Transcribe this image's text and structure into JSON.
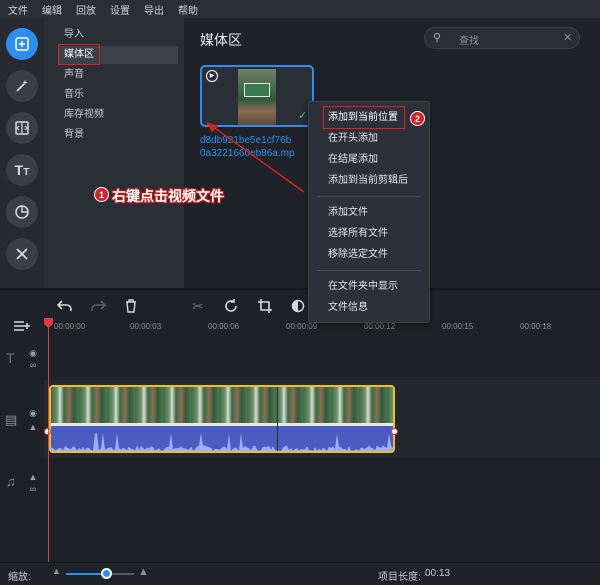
{
  "menu": [
    "文件",
    "编辑",
    "回放",
    "设置",
    "导出",
    "帮助"
  ],
  "sidebar_categories": [
    "导入",
    "媒体区",
    "声音",
    "音乐",
    "库存视频",
    "背景"
  ],
  "media": {
    "title": "媒体区",
    "search_placeholder": "查找",
    "file_name_line1": "d8db921be5e1cf76b",
    "file_name_line2": "0a3221660eb86a.mp"
  },
  "context_menu": {
    "group1": [
      "添加到当前位置",
      "在开头添加",
      "在结尾添加",
      "添加到当前剪辑后"
    ],
    "group2": [
      "添加文件",
      "选择所有文件",
      "移除选定文件"
    ],
    "group3": [
      "在文件夹中显示",
      "文件信息"
    ]
  },
  "annotations": {
    "badge1": "1",
    "badge2": "2",
    "step1_text": "右键点击视频文件"
  },
  "timeline": {
    "ticks": [
      "00:00:00",
      "00:00:03",
      "00:00:06",
      "00:00:09",
      "00:00:12",
      "00:00:15",
      "00:00:18"
    ]
  },
  "status": {
    "zoom_label": "缩放:",
    "project_length_label": "项目长度:",
    "project_length_value": "00:13",
    "zoom_level": 0.6
  },
  "colors": {
    "accent": "#2d8ef0",
    "clip_border": "#f0c020",
    "audio_wave": "#4a5cc0",
    "annotation_red": "#d6202a",
    "playhead": "#e33b3b"
  }
}
